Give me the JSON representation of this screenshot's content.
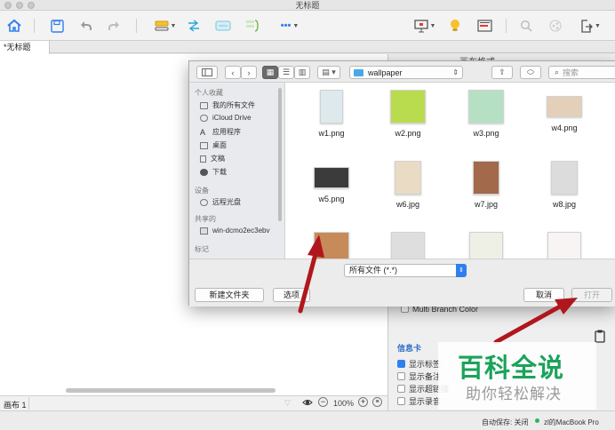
{
  "window": {
    "title": "无标题"
  },
  "toolbar": {
    "more_label": "•••"
  },
  "document": {
    "tab_label": "*无标题"
  },
  "bottom_bar": {
    "sheet_label": "画布 1",
    "zoom": "100%"
  },
  "status_bar": {
    "autosave": "自动保存: 关闭",
    "device": "zl的MacBook Pro"
  },
  "right_panel": {
    "partial_header": "画布格式",
    "multi_branch_color": "Multi Branch Color",
    "info_card_title": "信息卡",
    "info_items": [
      "显示标签",
      "显示备注",
      "显示超链接",
      "显示录音"
    ]
  },
  "dialog": {
    "location": "wallpaper",
    "search_placeholder": "搜索",
    "sidebar": {
      "favorites_header": "个人收藏",
      "favorites": [
        "我的所有文件",
        "iCloud Drive",
        "应用程序",
        "桌面",
        "文稿",
        "下载"
      ],
      "devices_header": "设备",
      "devices": [
        "远程光盘"
      ],
      "shared_header": "共享的",
      "shared": [
        "win-dcmo2ec3ebv"
      ],
      "tags_header": "标记"
    },
    "files": [
      {
        "name": "w1.png",
        "color": "#dde9ec"
      },
      {
        "name": "w2.png",
        "color": "#b9dc4e"
      },
      {
        "name": "w3.png",
        "color": "#b5e0c3"
      },
      {
        "name": "w4.png",
        "color": "#e4cfb8"
      },
      {
        "name": "w5.png",
        "color": "#3b3b3b"
      },
      {
        "name": "w6.jpg",
        "color": "#eadbc4"
      },
      {
        "name": "w7.jpg",
        "color": "#a2694b"
      },
      {
        "name": "w8.jpg",
        "color": "#dcdcdc"
      },
      {
        "name": "",
        "color": "#c78a59"
      },
      {
        "name": "",
        "color": "#dedede"
      },
      {
        "name": "",
        "color": "#eef0e6"
      },
      {
        "name": "",
        "color": "#f8f4f4"
      }
    ],
    "filter_value": "所有文件 (*.*)",
    "new_folder_label": "新建文件夹",
    "options_label": "选项",
    "cancel_label": "取消",
    "open_label": "打开"
  },
  "watermark": {
    "main": "百科全说",
    "sub": "助你轻松解决"
  },
  "colors": {
    "accent": "#2f7ff0",
    "arrow": "#b0171c",
    "watermark": "#1aa35a"
  }
}
